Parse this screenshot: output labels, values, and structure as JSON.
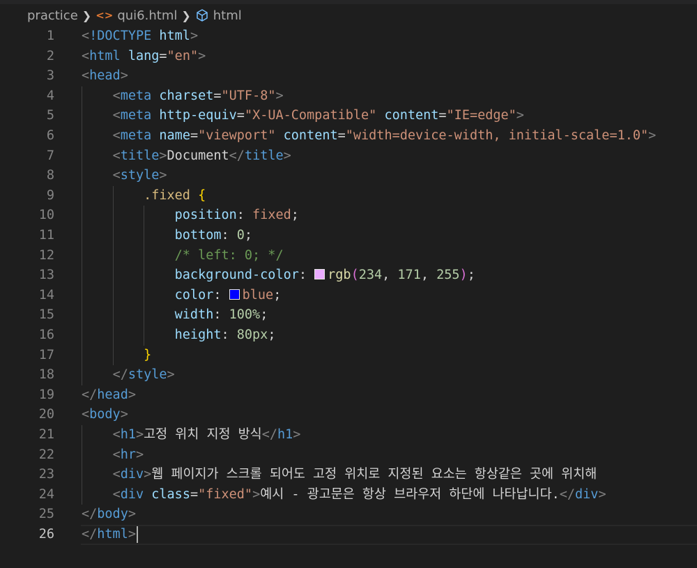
{
  "breadcrumb": {
    "folder": "practice",
    "file": "qui6.html",
    "symbol": "html",
    "file_icon": "html-file-icon",
    "symbol_icon": "cube-icon"
  },
  "swatch_colors": {
    "rgb_swatch": "#eaabff",
    "blue_swatch": "#0000ff"
  },
  "lines": [
    {
      "n": "1",
      "tokens": [
        [
          "punc",
          "<"
        ],
        [
          "tag",
          "!DOCTYPE"
        ],
        [
          "text",
          " "
        ],
        [
          "attr",
          "html"
        ],
        [
          "punc",
          ">"
        ]
      ]
    },
    {
      "n": "2",
      "tokens": [
        [
          "punc",
          "<"
        ],
        [
          "tag",
          "html"
        ],
        [
          "text",
          " "
        ],
        [
          "attr",
          "lang"
        ],
        [
          "text",
          "="
        ],
        [
          "str",
          "\"en\""
        ],
        [
          "punc",
          ">"
        ]
      ]
    },
    {
      "n": "3",
      "tokens": [
        [
          "punc",
          "<"
        ],
        [
          "tag",
          "head"
        ],
        [
          "punc",
          ">"
        ]
      ]
    },
    {
      "n": "4",
      "tokens": [
        [
          "text",
          "    "
        ],
        [
          "punc",
          "<"
        ],
        [
          "tag",
          "meta"
        ],
        [
          "text",
          " "
        ],
        [
          "attr",
          "charset"
        ],
        [
          "text",
          "="
        ],
        [
          "str",
          "\"UTF-8\""
        ],
        [
          "punc",
          ">"
        ]
      ]
    },
    {
      "n": "5",
      "tokens": [
        [
          "text",
          "    "
        ],
        [
          "punc",
          "<"
        ],
        [
          "tag",
          "meta"
        ],
        [
          "text",
          " "
        ],
        [
          "attr",
          "http-equiv"
        ],
        [
          "text",
          "="
        ],
        [
          "str",
          "\"X-UA-Compatible\""
        ],
        [
          "text",
          " "
        ],
        [
          "attr",
          "content"
        ],
        [
          "text",
          "="
        ],
        [
          "str",
          "\"IE=edge\""
        ],
        [
          "punc",
          ">"
        ]
      ]
    },
    {
      "n": "6",
      "tokens": [
        [
          "text",
          "    "
        ],
        [
          "punc",
          "<"
        ],
        [
          "tag",
          "meta"
        ],
        [
          "text",
          " "
        ],
        [
          "attr",
          "name"
        ],
        [
          "text",
          "="
        ],
        [
          "str",
          "\"viewport\""
        ],
        [
          "text",
          " "
        ],
        [
          "attr",
          "content"
        ],
        [
          "text",
          "="
        ],
        [
          "str",
          "\"width=device-width, initial-scale=1.0\""
        ],
        [
          "punc",
          ">"
        ]
      ]
    },
    {
      "n": "7",
      "tokens": [
        [
          "text",
          "    "
        ],
        [
          "punc",
          "<"
        ],
        [
          "tag",
          "title"
        ],
        [
          "punc",
          ">"
        ],
        [
          "text",
          "Document"
        ],
        [
          "punc",
          "</"
        ],
        [
          "tag",
          "title"
        ],
        [
          "punc",
          ">"
        ]
      ]
    },
    {
      "n": "8",
      "tokens": [
        [
          "text",
          "    "
        ],
        [
          "punc",
          "<"
        ],
        [
          "tag",
          "style"
        ],
        [
          "punc",
          ">"
        ]
      ]
    },
    {
      "n": "9",
      "tokens": [
        [
          "text",
          "        "
        ],
        [
          "sel",
          ".fixed"
        ],
        [
          "text",
          " "
        ],
        [
          "brace",
          "{"
        ]
      ]
    },
    {
      "n": "10",
      "tokens": [
        [
          "text",
          "            "
        ],
        [
          "prop",
          "position"
        ],
        [
          "text",
          ": "
        ],
        [
          "val",
          "fixed"
        ],
        [
          "text",
          ";"
        ]
      ]
    },
    {
      "n": "11",
      "tokens": [
        [
          "text",
          "            "
        ],
        [
          "prop",
          "bottom"
        ],
        [
          "text",
          ": "
        ],
        [
          "num",
          "0"
        ],
        [
          "text",
          ";"
        ]
      ]
    },
    {
      "n": "12",
      "tokens": [
        [
          "text",
          "            "
        ],
        [
          "cmt",
          "/* left: 0; */"
        ]
      ]
    },
    {
      "n": "13",
      "tokens": [
        [
          "text",
          "            "
        ],
        [
          "prop",
          "background-color"
        ],
        [
          "text",
          ": "
        ],
        [
          "swatch",
          "rgb_swatch"
        ],
        [
          "fn",
          "rgb"
        ],
        [
          "paren",
          "("
        ],
        [
          "num",
          "234"
        ],
        [
          "text",
          ", "
        ],
        [
          "num",
          "171"
        ],
        [
          "text",
          ", "
        ],
        [
          "num",
          "255"
        ],
        [
          "paren",
          ")"
        ],
        [
          "text",
          ";"
        ]
      ]
    },
    {
      "n": "14",
      "tokens": [
        [
          "text",
          "            "
        ],
        [
          "prop",
          "color"
        ],
        [
          "text",
          ": "
        ],
        [
          "swatch",
          "blue_swatch"
        ],
        [
          "val",
          "blue"
        ],
        [
          "text",
          ";"
        ]
      ]
    },
    {
      "n": "15",
      "tokens": [
        [
          "text",
          "            "
        ],
        [
          "prop",
          "width"
        ],
        [
          "text",
          ": "
        ],
        [
          "num",
          "100%"
        ],
        [
          "text",
          ";"
        ]
      ]
    },
    {
      "n": "16",
      "tokens": [
        [
          "text",
          "            "
        ],
        [
          "prop",
          "height"
        ],
        [
          "text",
          ": "
        ],
        [
          "num",
          "80px"
        ],
        [
          "text",
          ";"
        ]
      ]
    },
    {
      "n": "17",
      "tokens": [
        [
          "text",
          "        "
        ],
        [
          "brace",
          "}"
        ]
      ]
    },
    {
      "n": "18",
      "tokens": [
        [
          "text",
          "    "
        ],
        [
          "punc",
          "</"
        ],
        [
          "tag",
          "style"
        ],
        [
          "punc",
          ">"
        ]
      ]
    },
    {
      "n": "19",
      "tokens": [
        [
          "punc",
          "</"
        ],
        [
          "tag",
          "head"
        ],
        [
          "punc",
          ">"
        ]
      ]
    },
    {
      "n": "20",
      "tokens": [
        [
          "punc",
          "<"
        ],
        [
          "tag",
          "body"
        ],
        [
          "punc",
          ">"
        ]
      ]
    },
    {
      "n": "21",
      "tokens": [
        [
          "text",
          "    "
        ],
        [
          "punc",
          "<"
        ],
        [
          "tag",
          "h1"
        ],
        [
          "punc",
          ">"
        ],
        [
          "text",
          "고정 위치 지정 방식"
        ],
        [
          "punc",
          "</"
        ],
        [
          "tag",
          "h1"
        ],
        [
          "punc",
          ">"
        ]
      ]
    },
    {
      "n": "22",
      "tokens": [
        [
          "text",
          "    "
        ],
        [
          "punc",
          "<"
        ],
        [
          "tag",
          "hr"
        ],
        [
          "punc",
          ">"
        ]
      ]
    },
    {
      "n": "23",
      "tokens": [
        [
          "text",
          "    "
        ],
        [
          "punc",
          "<"
        ],
        [
          "tag",
          "div"
        ],
        [
          "punc",
          ">"
        ],
        [
          "text",
          "웹 페이지가 스크롤 되어도 고정 위치로 지정된 요소는 항상같은 곳에 위치해"
        ]
      ]
    },
    {
      "n": "24",
      "tokens": [
        [
          "text",
          "    "
        ],
        [
          "punc",
          "<"
        ],
        [
          "tag",
          "div"
        ],
        [
          "text",
          " "
        ],
        [
          "attr",
          "class"
        ],
        [
          "text",
          "="
        ],
        [
          "str",
          "\"fixed\""
        ],
        [
          "punc",
          ">"
        ],
        [
          "text",
          "예시 - 광고문은 항상 브라우저 하단에 나타납니다."
        ],
        [
          "punc",
          "</"
        ],
        [
          "tag",
          "div"
        ],
        [
          "punc",
          ">"
        ]
      ]
    },
    {
      "n": "25",
      "tokens": [
        [
          "punc",
          "</"
        ],
        [
          "tag",
          "body"
        ],
        [
          "punc",
          ">"
        ]
      ]
    },
    {
      "n": "26",
      "tokens": [
        [
          "punc",
          "</"
        ],
        [
          "tag",
          "html"
        ],
        [
          "punc",
          ">"
        ]
      ]
    }
  ]
}
